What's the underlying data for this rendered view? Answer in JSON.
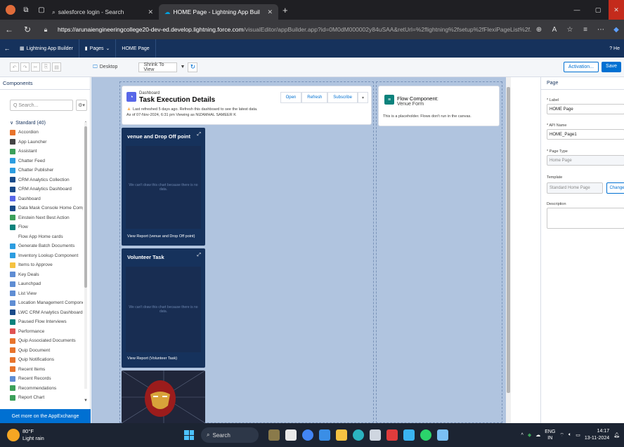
{
  "browser": {
    "tabs": [
      {
        "label": "salesforce login - Search",
        "active": false
      },
      {
        "label": "HOME Page - Lightning App Buil",
        "active": true
      }
    ],
    "url_host": "https://arunaiengineeringcollege20-dev-ed.develop.lightning.force.com",
    "url_path": "/visualEditor/appBuilder.app?id=0M0dM000002y84uSAA&retUrl=%2flightning%2fsetup%2fFlexiPageList%2f..."
  },
  "app_header": {
    "app_name": "Lightning App Builder",
    "pages_label": "Pages",
    "page_name": "HOME Page",
    "help": "? He"
  },
  "toolbar": {
    "device": "Desktop",
    "view": "Shrink To View",
    "activation": "Activation...",
    "save": "Save"
  },
  "left_panel": {
    "title": "Components",
    "search_placeholder": "Q Search...",
    "section": "Standard (40)",
    "components": [
      {
        "label": "Accordion",
        "color": "#e8742c"
      },
      {
        "label": "App Launcher",
        "color": "#444444"
      },
      {
        "label": "Assistant",
        "color": "#3ca05a"
      },
      {
        "label": "Chatter Feed",
        "color": "#2d9de0"
      },
      {
        "label": "Chatter Publisher",
        "color": "#2d9de0"
      },
      {
        "label": "CRM Analytics Collection",
        "color": "#1a4b8a"
      },
      {
        "label": "CRM Analytics Dashboard",
        "color": "#1a4b8a"
      },
      {
        "label": "Dashboard",
        "color": "#5867e8"
      },
      {
        "label": "Data Mask Console Home Compo...",
        "color": "#1a4b8a"
      },
      {
        "label": "Einstein Next Best Action",
        "color": "#3ca05a"
      },
      {
        "label": "Flow",
        "color": "#0b827c"
      },
      {
        "label": "Flow App Home cards",
        "color": "#ffffff"
      },
      {
        "label": "Generate Batch Documents",
        "color": "#2d9de0"
      },
      {
        "label": "Inventory Lookup Component",
        "color": "#2d9de0"
      },
      {
        "label": "Items to Approve",
        "color": "#f5c242"
      },
      {
        "label": "Key Deals",
        "color": "#5f8dd3"
      },
      {
        "label": "Launchpad",
        "color": "#5f8dd3"
      },
      {
        "label": "List View",
        "color": "#5f8dd3"
      },
      {
        "label": "Location Management Component",
        "color": "#5f8dd3"
      },
      {
        "label": "LWC CRM Analytics Dashboard",
        "color": "#1a4b8a"
      },
      {
        "label": "Paused Flow Interviews",
        "color": "#0b827c"
      },
      {
        "label": "Performance",
        "color": "#e05252"
      },
      {
        "label": "Quip Associated Documents",
        "color": "#e8742c"
      },
      {
        "label": "Quip Document",
        "color": "#e8742c"
      },
      {
        "label": "Quip Notifications",
        "color": "#e8742c"
      },
      {
        "label": "Recent Items",
        "color": "#e8742c"
      },
      {
        "label": "Recent Records",
        "color": "#5f8dd3"
      },
      {
        "label": "Recommendations",
        "color": "#3ca05a"
      },
      {
        "label": "Report Chart",
        "color": "#3ca05a"
      }
    ],
    "appexchange": "Get more on the AppExchange"
  },
  "canvas": {
    "dashboard": {
      "subtitle": "Dashboard",
      "title": "Task Execution Details",
      "warning": "Last refreshed 5 days ago. Refresh this dashboard to see the latest data.",
      "as_of": "As of 07-Nov-2024, 6:31 pm Viewing as NIZAMHAL SAMEER K",
      "buttons": [
        "Open",
        "Refresh",
        "Subscribe"
      ]
    },
    "charts": [
      {
        "title": "venue and Drop Off point",
        "message": "We can't draw this chart because there is no data.",
        "report_link": "View Report (venue and Drop Off point)"
      },
      {
        "title": "Volunteer Task",
        "message": "We can't draw this chart because there is no data.",
        "report_link": "View Report (Volunteer Task)"
      }
    ],
    "flow": {
      "title": "Flow Component:",
      "subtitle": "Venue Form",
      "note": "This is a placeholder. Flows don't run in the canvas."
    }
  },
  "right_panel": {
    "title": "Page",
    "label_label": "* Label",
    "label_value": "HOME Page",
    "api_label": "* API Name",
    "api_value": "HOME_Page1",
    "type_label": "* Page Type",
    "type_value": "Home Page",
    "template_label": "Template",
    "template_value": "Standard Home Page",
    "change": "Change",
    "description_label": "Description"
  },
  "taskbar": {
    "weather_temp": "80°F",
    "weather_desc": "Light rain",
    "search": "Search",
    "lang_1": "ENG",
    "lang_2": "IN",
    "time": "14:17",
    "date": "13-11-2024"
  }
}
